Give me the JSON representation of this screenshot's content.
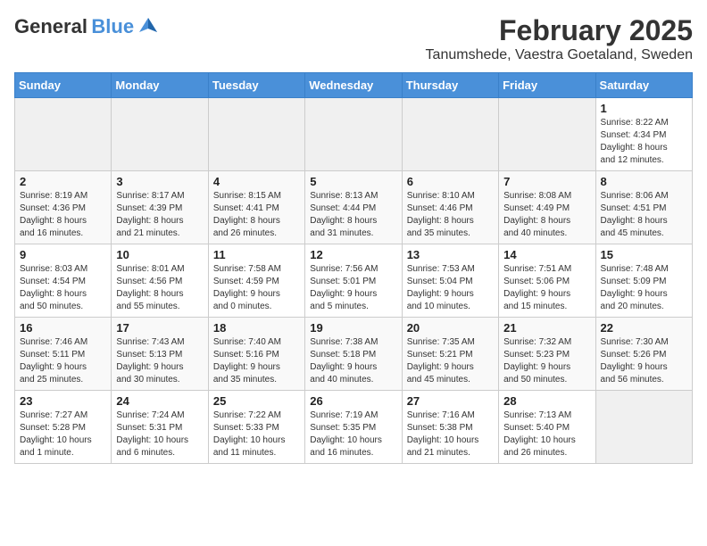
{
  "logo": {
    "general": "General",
    "blue": "Blue"
  },
  "title": "February 2025",
  "subtitle": "Tanumshede, Vaestra Goetaland, Sweden",
  "days_of_week": [
    "Sunday",
    "Monday",
    "Tuesday",
    "Wednesday",
    "Thursday",
    "Friday",
    "Saturday"
  ],
  "weeks": [
    [
      {
        "num": "",
        "info": ""
      },
      {
        "num": "",
        "info": ""
      },
      {
        "num": "",
        "info": ""
      },
      {
        "num": "",
        "info": ""
      },
      {
        "num": "",
        "info": ""
      },
      {
        "num": "",
        "info": ""
      },
      {
        "num": "1",
        "info": "Sunrise: 8:22 AM\nSunset: 4:34 PM\nDaylight: 8 hours\nand 12 minutes."
      }
    ],
    [
      {
        "num": "2",
        "info": "Sunrise: 8:19 AM\nSunset: 4:36 PM\nDaylight: 8 hours\nand 16 minutes."
      },
      {
        "num": "3",
        "info": "Sunrise: 8:17 AM\nSunset: 4:39 PM\nDaylight: 8 hours\nand 21 minutes."
      },
      {
        "num": "4",
        "info": "Sunrise: 8:15 AM\nSunset: 4:41 PM\nDaylight: 8 hours\nand 26 minutes."
      },
      {
        "num": "5",
        "info": "Sunrise: 8:13 AM\nSunset: 4:44 PM\nDaylight: 8 hours\nand 31 minutes."
      },
      {
        "num": "6",
        "info": "Sunrise: 8:10 AM\nSunset: 4:46 PM\nDaylight: 8 hours\nand 35 minutes."
      },
      {
        "num": "7",
        "info": "Sunrise: 8:08 AM\nSunset: 4:49 PM\nDaylight: 8 hours\nand 40 minutes."
      },
      {
        "num": "8",
        "info": "Sunrise: 8:06 AM\nSunset: 4:51 PM\nDaylight: 8 hours\nand 45 minutes."
      }
    ],
    [
      {
        "num": "9",
        "info": "Sunrise: 8:03 AM\nSunset: 4:54 PM\nDaylight: 8 hours\nand 50 minutes."
      },
      {
        "num": "10",
        "info": "Sunrise: 8:01 AM\nSunset: 4:56 PM\nDaylight: 8 hours\nand 55 minutes."
      },
      {
        "num": "11",
        "info": "Sunrise: 7:58 AM\nSunset: 4:59 PM\nDaylight: 9 hours\nand 0 minutes."
      },
      {
        "num": "12",
        "info": "Sunrise: 7:56 AM\nSunset: 5:01 PM\nDaylight: 9 hours\nand 5 minutes."
      },
      {
        "num": "13",
        "info": "Sunrise: 7:53 AM\nSunset: 5:04 PM\nDaylight: 9 hours\nand 10 minutes."
      },
      {
        "num": "14",
        "info": "Sunrise: 7:51 AM\nSunset: 5:06 PM\nDaylight: 9 hours\nand 15 minutes."
      },
      {
        "num": "15",
        "info": "Sunrise: 7:48 AM\nSunset: 5:09 PM\nDaylight: 9 hours\nand 20 minutes."
      }
    ],
    [
      {
        "num": "16",
        "info": "Sunrise: 7:46 AM\nSunset: 5:11 PM\nDaylight: 9 hours\nand 25 minutes."
      },
      {
        "num": "17",
        "info": "Sunrise: 7:43 AM\nSunset: 5:13 PM\nDaylight: 9 hours\nand 30 minutes."
      },
      {
        "num": "18",
        "info": "Sunrise: 7:40 AM\nSunset: 5:16 PM\nDaylight: 9 hours\nand 35 minutes."
      },
      {
        "num": "19",
        "info": "Sunrise: 7:38 AM\nSunset: 5:18 PM\nDaylight: 9 hours\nand 40 minutes."
      },
      {
        "num": "20",
        "info": "Sunrise: 7:35 AM\nSunset: 5:21 PM\nDaylight: 9 hours\nand 45 minutes."
      },
      {
        "num": "21",
        "info": "Sunrise: 7:32 AM\nSunset: 5:23 PM\nDaylight: 9 hours\nand 50 minutes."
      },
      {
        "num": "22",
        "info": "Sunrise: 7:30 AM\nSunset: 5:26 PM\nDaylight: 9 hours\nand 56 minutes."
      }
    ],
    [
      {
        "num": "23",
        "info": "Sunrise: 7:27 AM\nSunset: 5:28 PM\nDaylight: 10 hours\nand 1 minute."
      },
      {
        "num": "24",
        "info": "Sunrise: 7:24 AM\nSunset: 5:31 PM\nDaylight: 10 hours\nand 6 minutes."
      },
      {
        "num": "25",
        "info": "Sunrise: 7:22 AM\nSunset: 5:33 PM\nDaylight: 10 hours\nand 11 minutes."
      },
      {
        "num": "26",
        "info": "Sunrise: 7:19 AM\nSunset: 5:35 PM\nDaylight: 10 hours\nand 16 minutes."
      },
      {
        "num": "27",
        "info": "Sunrise: 7:16 AM\nSunset: 5:38 PM\nDaylight: 10 hours\nand 21 minutes."
      },
      {
        "num": "28",
        "info": "Sunrise: 7:13 AM\nSunset: 5:40 PM\nDaylight: 10 hours\nand 26 minutes."
      },
      {
        "num": "",
        "info": ""
      }
    ]
  ]
}
